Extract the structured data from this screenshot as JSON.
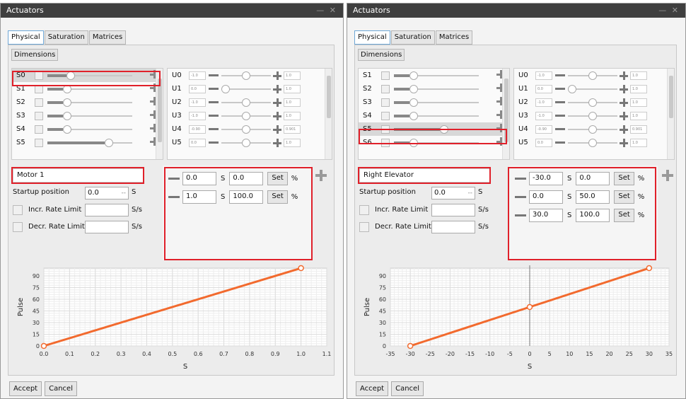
{
  "left": {
    "title": "Actuators",
    "window_controls": "— ✕",
    "tabs": [
      "Physical",
      "Saturation",
      "Matrices"
    ],
    "dimensions_label": "Dimensions",
    "servos": [
      "S0",
      "S1",
      "S2",
      "S3",
      "S4",
      "S5"
    ],
    "servo_levels": [
      0.25,
      0.2,
      0.2,
      0.2,
      0.2,
      0.75
    ],
    "selected_servo": "S0",
    "outputs": [
      {
        "name": "U0",
        "value": "-1.0",
        "level": 0.5,
        "end": "1.0"
      },
      {
        "name": "U1",
        "value": "0.0",
        "level": 0.0,
        "end": "1.0"
      },
      {
        "name": "U2",
        "value": "-1.0",
        "level": 0.5,
        "end": "1.0"
      },
      {
        "name": "U3",
        "value": "-1.0",
        "level": 0.5,
        "end": "1.0"
      },
      {
        "name": "U4",
        "value": "-0.90",
        "level": 0.5,
        "end": "0.901"
      },
      {
        "name": "U5",
        "value": "0.0",
        "level": 0.5,
        "end": "1.0"
      }
    ],
    "actuator_name": "Motor 1",
    "startup_label": "Startup position",
    "startup_value": "0.0",
    "startup_dashes": "--",
    "startup_unit": "S",
    "incr_label": "Incr. Rate Limit",
    "incr_unit": "S/s",
    "decr_label": "Decr. Rate Limit",
    "decr_unit": "S/s",
    "points": [
      {
        "s": "0.0",
        "unit": "S",
        "pct": "0.0",
        "set": "Set",
        "pct_sign": "%"
      },
      {
        "s": "1.0",
        "unit": "S",
        "pct": "100.0",
        "set": "Set",
        "pct_sign": "%"
      }
    ],
    "accept_label": "Accept",
    "cancel_label": "Cancel"
  },
  "right": {
    "title": "Actuators",
    "window_controls": "— ✕",
    "tabs": [
      "Physical",
      "Saturation",
      "Matrices"
    ],
    "dimensions_label": "Dimensions",
    "servos": [
      "S1",
      "S2",
      "S3",
      "S4",
      "S5",
      "S6"
    ],
    "servo_levels": [
      0.2,
      0.2,
      0.2,
      0.2,
      0.6,
      0.2
    ],
    "selected_servo": "S5",
    "outputs": [
      {
        "name": "U0",
        "value": "-1.0",
        "level": 0.5,
        "end": "1.0"
      },
      {
        "name": "U1",
        "value": "0.0",
        "level": 0.0,
        "end": "1.0"
      },
      {
        "name": "U2",
        "value": "-1.0",
        "level": 0.5,
        "end": "1.0"
      },
      {
        "name": "U3",
        "value": "-1.0",
        "level": 0.5,
        "end": "1.0"
      },
      {
        "name": "U4",
        "value": "-0.90",
        "level": 0.5,
        "end": "0.901"
      },
      {
        "name": "U5",
        "value": "0.0",
        "level": 0.5,
        "end": "1.0"
      }
    ],
    "actuator_name": "Right Elevator",
    "startup_label": "Startup position",
    "startup_value": "0.0",
    "startup_dashes": "--",
    "startup_unit": "S",
    "incr_label": "Incr. Rate Limit",
    "incr_unit": "S/s",
    "decr_label": "Decr. Rate Limit",
    "decr_unit": "S/s",
    "points": [
      {
        "s": "-30.0",
        "unit": "S",
        "pct": "0.0",
        "set": "Set",
        "pct_sign": "%"
      },
      {
        "s": "0.0",
        "unit": "S",
        "pct": "50.0",
        "set": "Set",
        "pct_sign": "%"
      },
      {
        "s": "30.0",
        "unit": "S",
        "pct": "100.0",
        "set": "Set",
        "pct_sign": "%"
      }
    ],
    "accept_label": "Accept",
    "cancel_label": "Cancel"
  },
  "chart_data": [
    {
      "type": "line",
      "xlabel": "S",
      "ylabel": "Pulse",
      "x": [
        0.0,
        1.0
      ],
      "y": [
        0,
        100
      ],
      "xlim": [
        0,
        1.1
      ],
      "ylim": [
        0,
        100
      ],
      "xticks": [
        "0.0",
        "0.1",
        "0.2",
        "0.3",
        "0.4",
        "0.5",
        "0.6",
        "0.7",
        "0.8",
        "0.9",
        "1.0",
        "1.1"
      ],
      "yticks": [
        "0",
        "15",
        "30",
        "45",
        "60",
        "75",
        "90"
      ],
      "grid": true,
      "line_color": "#f26a2e"
    },
    {
      "type": "line",
      "xlabel": "S",
      "ylabel": "Pulse",
      "x": [
        -30,
        0,
        30
      ],
      "y": [
        0,
        50,
        100
      ],
      "xlim": [
        -35,
        35
      ],
      "ylim": [
        0,
        100
      ],
      "xticks": [
        "-35",
        "-30",
        "-25",
        "-20",
        "-15",
        "-10",
        "-5",
        "0",
        "5",
        "10",
        "15",
        "20",
        "25",
        "30",
        "35"
      ],
      "yticks": [
        "0",
        "15",
        "30",
        "45",
        "60",
        "75",
        "90"
      ],
      "grid": true,
      "line_color": "#f26a2e"
    }
  ]
}
